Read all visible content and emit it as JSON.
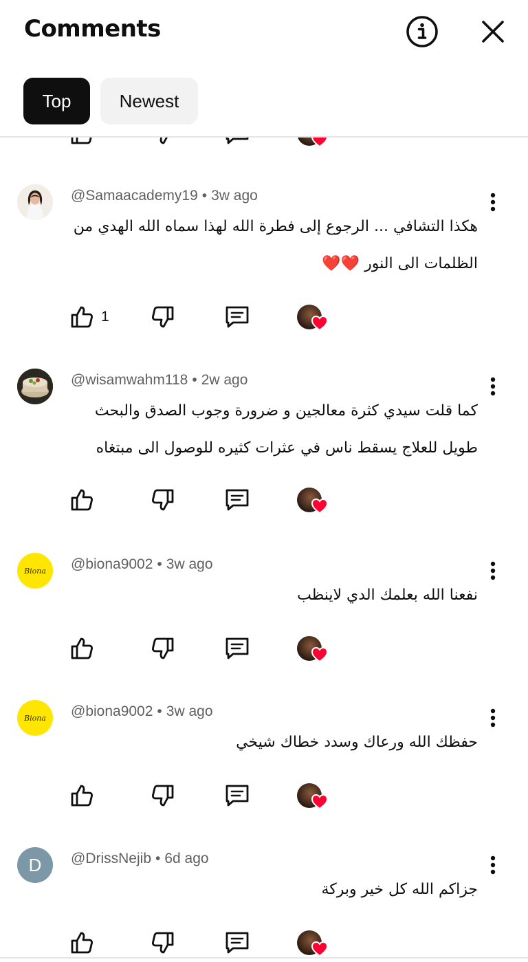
{
  "header": {
    "title": "Comments"
  },
  "chips": [
    {
      "label": "Top",
      "selected": true
    },
    {
      "label": "Newest",
      "selected": false
    }
  ],
  "comments": [
    {
      "author": "@Samaacademy19",
      "time": "3w ago",
      "lines": [
        "هكذا التشافي ... الرجوع إلى فطرة الله لهذا سماه الله الهدي من",
        "الظلمات الى النور ❤️❤️"
      ],
      "likes": "1",
      "avatar": "photo-woman"
    },
    {
      "author": "@wisamwahm118",
      "time": "2w ago",
      "lines": [
        "كما قلت سيدي كثرة معالجين و ضرورة وجوب الصدق والبحث",
        "طويل للعلاج يسقط ناس في عثرات كثيره للوصول الى مبتغاه"
      ],
      "likes": "",
      "avatar": "photo-cake"
    },
    {
      "author": "@biona9002",
      "time": "3w ago",
      "lines": [
        "نفعنا الله بعلمك  الدي لاينظب"
      ],
      "likes": "",
      "avatar": "logo-biona",
      "avatar_text": "Biona"
    },
    {
      "author": "@biona9002",
      "time": "3w ago",
      "lines": [
        "حفظك الله ورعاك وسدد خطاك شيخي"
      ],
      "likes": "",
      "avatar": "logo-biona",
      "avatar_text": "Biona"
    },
    {
      "author": "@DrissNejib",
      "time": "6d ago",
      "lines": [
        "جزاكم  الله كل خير وبركة"
      ],
      "likes": "",
      "avatar": "letter",
      "avatar_text": "D"
    }
  ],
  "separator": "•",
  "colors": {
    "heart": "#ff0033",
    "biona_yellow": "#ffe600",
    "letter_avatar": "#7c98a6",
    "meta_gray": "#606060"
  }
}
